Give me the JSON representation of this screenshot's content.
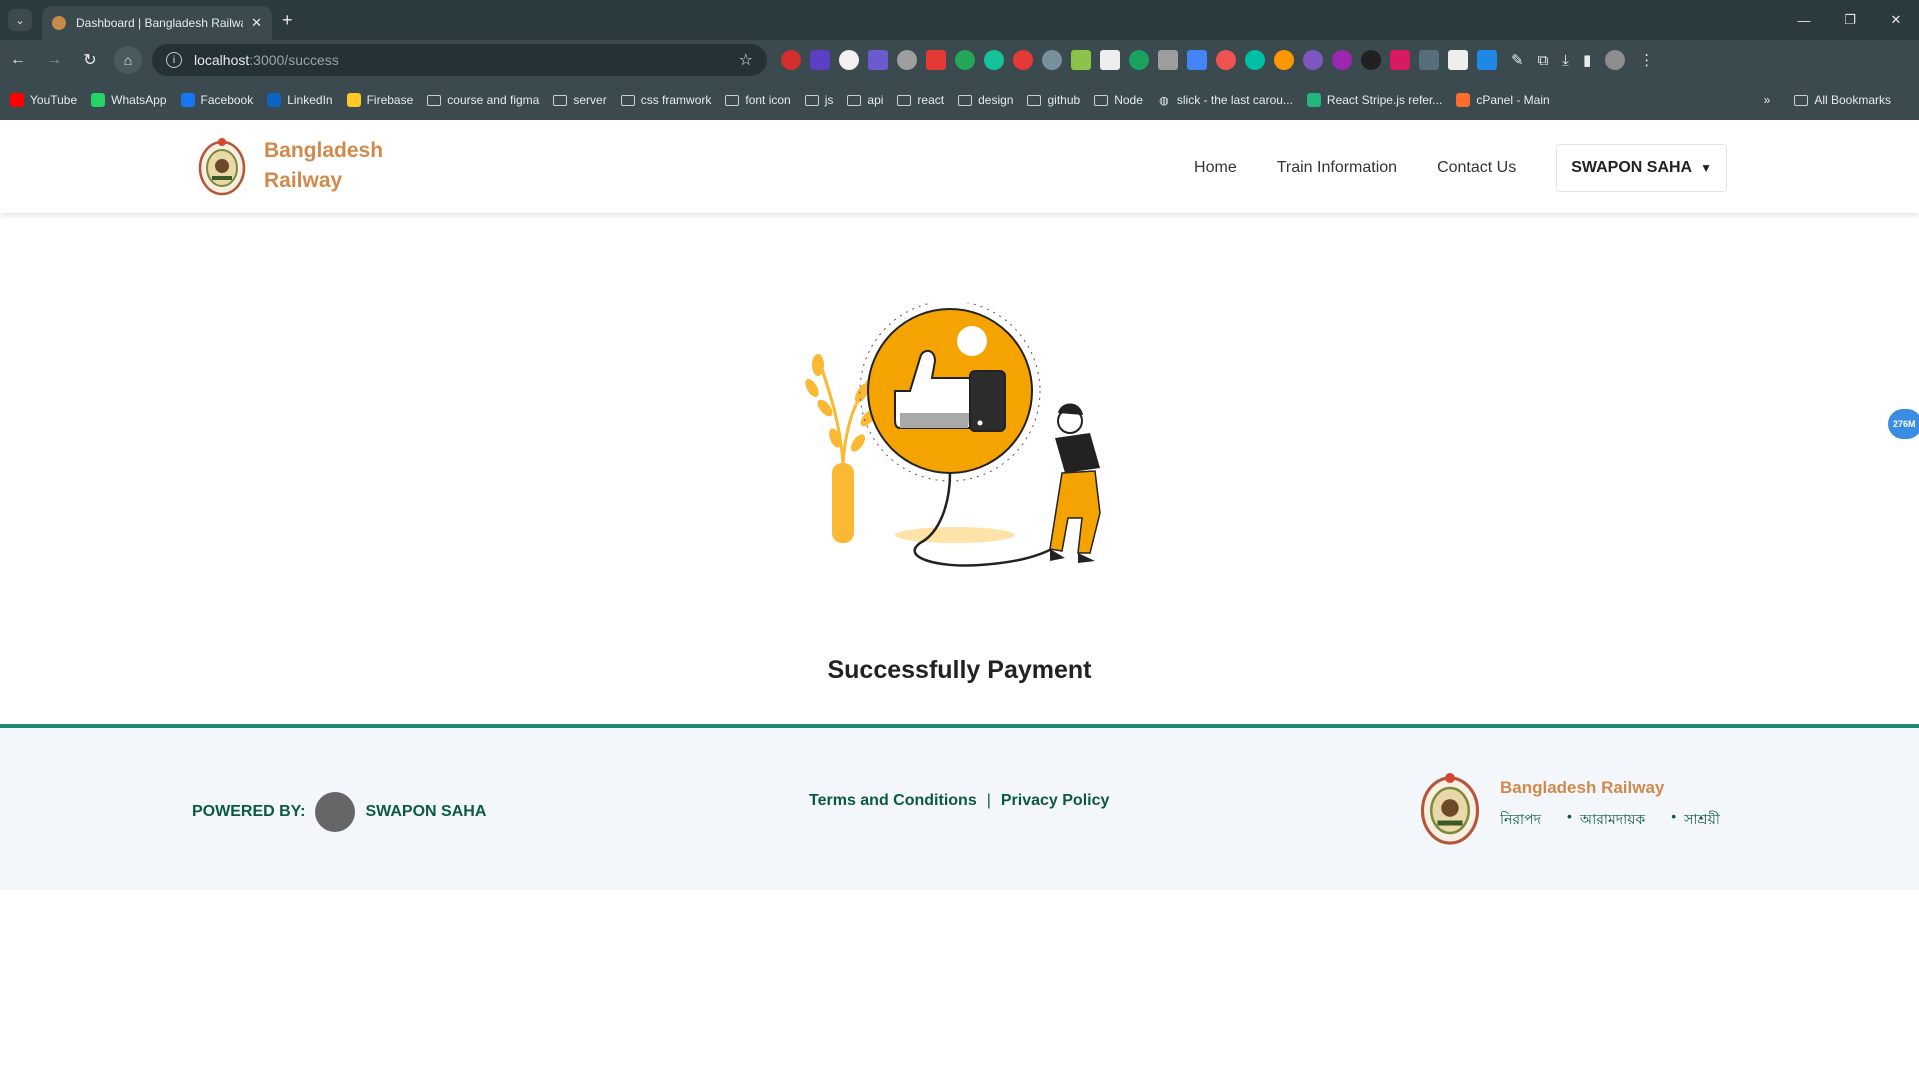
{
  "browser": {
    "tab_title": "Dashboard | Bangladesh Railwa",
    "url_host": "localhost",
    "url_path": ":3000/success",
    "bookmarks": [
      {
        "label": "YouTube",
        "icon": "youtube-icon",
        "color": "#ff0000"
      },
      {
        "label": "WhatsApp",
        "icon": "whatsapp-icon",
        "color": "#25d366"
      },
      {
        "label": "Facebook",
        "icon": "facebook-icon",
        "color": "#1877f2"
      },
      {
        "label": "LinkedIn",
        "icon": "linkedin-icon",
        "color": "#0a66c2"
      },
      {
        "label": "Firebase",
        "icon": "firebase-icon",
        "color": "#ffca28"
      },
      {
        "label": "course and figma",
        "icon": "folder-icon"
      },
      {
        "label": "server",
        "icon": "folder-icon"
      },
      {
        "label": "css framwork",
        "icon": "folder-icon"
      },
      {
        "label": "font icon",
        "icon": "folder-icon"
      },
      {
        "label": "js",
        "icon": "folder-icon"
      },
      {
        "label": "api",
        "icon": "folder-icon"
      },
      {
        "label": "react",
        "icon": "folder-icon"
      },
      {
        "label": "design",
        "icon": "folder-icon"
      },
      {
        "label": "github",
        "icon": "folder-icon"
      },
      {
        "label": "Node",
        "icon": "folder-icon"
      },
      {
        "label": "slick - the last carou...",
        "icon": "globe-icon"
      },
      {
        "label": "React Stripe.js refer...",
        "icon": "stripe-icon",
        "color": "#24b47e"
      },
      {
        "label": "cPanel - Main",
        "icon": "cpanel-icon",
        "color": "#ff6c2c"
      }
    ],
    "all_bookmarks": "All Bookmarks"
  },
  "header": {
    "brand_line1": "Bangladesh",
    "brand_line2": "Railway",
    "nav": [
      "Home",
      "Train Information",
      "Contact Us"
    ],
    "user": "SWAPON SAHA"
  },
  "main": {
    "message": "Successfully Payment"
  },
  "footer": {
    "powered_by": "POWERED BY:",
    "author": "SWAPON SAHA",
    "terms": "Terms and Conditions",
    "privacy": "Privacy Policy",
    "brand": "Bangladesh Railway",
    "tags": [
      "নিরাপদ",
      "আরামদায়ক",
      "সাশ্রয়ী"
    ]
  },
  "floating_badge": "276M",
  "colors": {
    "brand": "#d28a4c",
    "footer_green": "#0b5a3f",
    "footer_border": "#1c8a6e",
    "illustration_orange": "#f5a623"
  }
}
